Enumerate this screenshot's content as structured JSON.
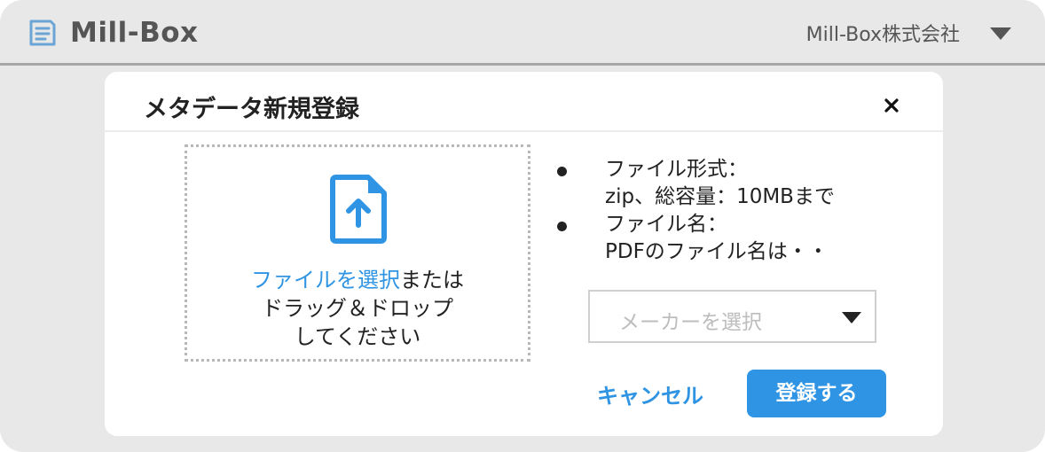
{
  "header": {
    "logo_text": "Mill-Box",
    "company_name": "Mill-Box株式会社"
  },
  "dialog": {
    "title": "メタデータ新規登録",
    "dropzone": {
      "select_link": "ファイルを選択",
      "line1_rest": "または",
      "line2": "ドラッグ＆ドロップ",
      "line3": "してください"
    },
    "info": [
      {
        "label": "ファイル形式：",
        "detail": "zip、総容量：10MBまで"
      },
      {
        "label": "ファイル名：",
        "detail": "PDFのファイル名は・・"
      }
    ],
    "maker_select": {
      "placeholder": "メーカーを選択"
    },
    "cancel_label": "キャンセル",
    "submit_label": "登録する"
  },
  "colors": {
    "accent": "#2f94e3",
    "background": "#e8e8e8",
    "dialog": "#ffffff",
    "text": "#222222"
  },
  "icons": [
    "mill-box-logo-icon",
    "chevron-down-icon",
    "close-icon",
    "file-upload-icon"
  ]
}
